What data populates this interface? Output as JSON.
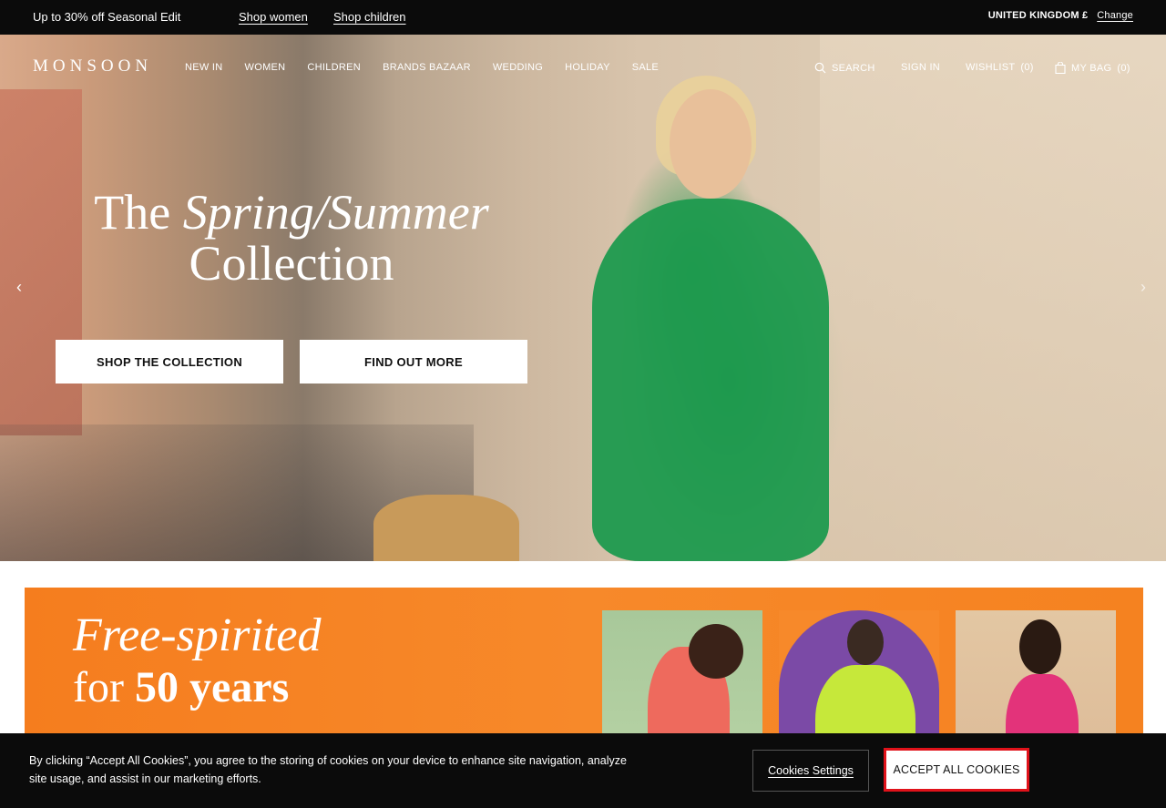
{
  "promo": {
    "text": "Up to 30% off Seasonal Edit",
    "links": [
      "Shop women",
      "Shop children"
    ]
  },
  "region": {
    "label": "UNITED KINGDOM £",
    "change": "Change"
  },
  "header": {
    "logo": "MONSOON",
    "nav": [
      "NEW IN",
      "WOMEN",
      "CHILDREN",
      "BRANDS BAZAAR",
      "WEDDING",
      "HOLIDAY",
      "SALE"
    ],
    "search": "SEARCH",
    "signin": "SIGN IN",
    "wishlist": "WISHLIST",
    "wishlist_count": "(0)",
    "bag": "MY BAG",
    "bag_count": "(0)"
  },
  "hero": {
    "title_the": "The ",
    "title_italic": "Spring/Summer",
    "title_collection": "Collection",
    "buttons": [
      "SHOP THE COLLECTION",
      "FIND OUT MORE"
    ],
    "arrow_left": "‹",
    "arrow_right": "›"
  },
  "banner": {
    "line1": "Free-spirited",
    "line2_a": "for ",
    "line2_b": "50 years"
  },
  "cookie": {
    "text": "By clicking “Accept All Cookies”, you agree to the storing of cookies on your device to enhance site navigation, analyze site usage, and assist in our marketing efforts.",
    "settings": "Cookies Settings",
    "accept": "ACCEPT ALL COOKIES",
    "accept_border_color": "#e0121a"
  }
}
